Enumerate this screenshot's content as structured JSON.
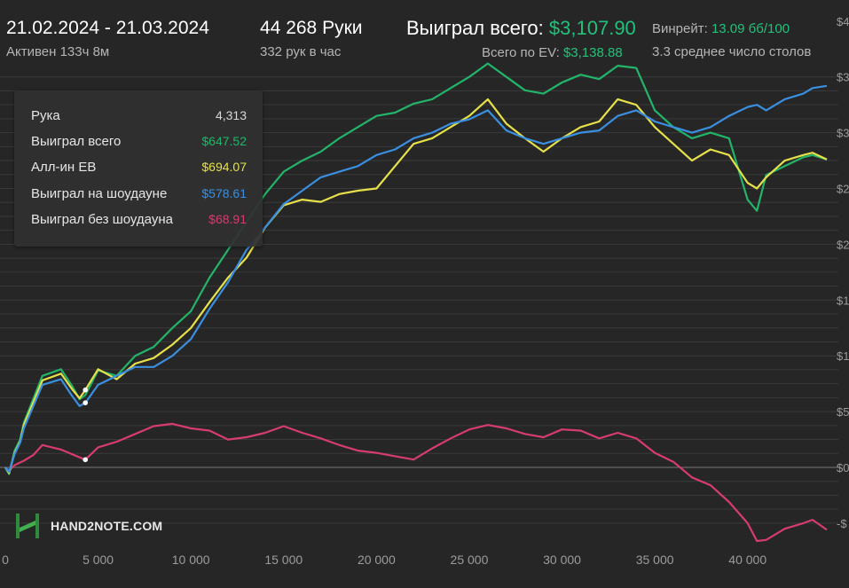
{
  "header": {
    "date_range": "21.02.2024 - 21.03.2024",
    "active_time": "Активен 133ч 8м",
    "hands_count": "44 268 Руки",
    "hands_per_hour": "332 рук в час",
    "won_total_label": "Выиграл всего:",
    "won_total_value": "$3,107.90",
    "ev_total_label": "Всего по EV:",
    "ev_total_value": "$3,138.88",
    "winrate_label": "Винрейт:",
    "winrate_value": "13.09 бб/100",
    "avg_tables": "3.3 среднее число столов"
  },
  "tooltip": {
    "rows": [
      {
        "label": "Рука",
        "value": "4,313",
        "color": "#d8d8d8"
      },
      {
        "label": "Выиграл всего",
        "value": "$647.52",
        "color": "#22b56a"
      },
      {
        "label": "Алл-ин ЕВ",
        "value": "$694.07",
        "color": "#e6e04a"
      },
      {
        "label": "Выиграл на шоудауне",
        "value": "$578.61",
        "color": "#3a8fe0"
      },
      {
        "label": "Выиграл без шоудауна",
        "value": "$68.91",
        "color": "#d63c6e"
      }
    ]
  },
  "logo": {
    "text": "HAND2NOTE.COM",
    "icon": "hand2note-logo-icon"
  },
  "chart_data": {
    "type": "line",
    "x_axis": {
      "range": [
        0,
        44268
      ],
      "ticks": [
        0,
        5000,
        10000,
        15000,
        20000,
        25000,
        30000,
        35000,
        40000
      ],
      "tick_labels": [
        "0",
        "5 000",
        "10 000",
        "15 000",
        "20 000",
        "25 000",
        "30 000",
        "35 000",
        "40 000"
      ]
    },
    "y_axis": {
      "position": "right",
      "range": [
        -600,
        4000
      ],
      "tick_values": [
        -500,
        0,
        500,
        1000,
        1500,
        2000,
        2500,
        3000,
        3500,
        4000
      ],
      "tick_labels": [
        "-$",
        "$0",
        "$5",
        "$1",
        "$1",
        "$2",
        "$2",
        "$3",
        "$3",
        "$4"
      ]
    },
    "grid": true,
    "series": [
      {
        "name": "Выиграл всего",
        "color": "#22b56a",
        "x": [
          0,
          200,
          500,
          800,
          1000,
          2000,
          3000,
          3600,
          4000,
          4313,
          5000,
          6000,
          7000,
          8000,
          9000,
          10000,
          11000,
          12000,
          13000,
          14000,
          15000,
          16000,
          17000,
          18000,
          19000,
          20000,
          21000,
          22000,
          23000,
          24000,
          25000,
          26000,
          27000,
          28000,
          29000,
          30000,
          31000,
          32000,
          33000,
          34000,
          35000,
          36000,
          37000,
          38000,
          39000,
          40000,
          40500,
          41000,
          42000,
          43000,
          43500,
          44268
        ],
        "y": [
          0,
          -60,
          150,
          250,
          400,
          820,
          880,
          730,
          610,
          648,
          870,
          820,
          1000,
          1080,
          1250,
          1400,
          1700,
          1950,
          2200,
          2450,
          2650,
          2750,
          2830,
          2950,
          3050,
          3150,
          3180,
          3260,
          3300,
          3400,
          3500,
          3620,
          3500,
          3380,
          3350,
          3450,
          3520,
          3480,
          3600,
          3580,
          3200,
          3050,
          2950,
          3000,
          2950,
          2400,
          2300,
          2620,
          2700,
          2780,
          2800,
          2760
        ]
      },
      {
        "name": "Алл-ин ЕВ",
        "color": "#e6e04a",
        "x": [
          0,
          200,
          500,
          800,
          1000,
          2000,
          3000,
          3600,
          4000,
          4313,
          5000,
          6000,
          7000,
          8000,
          9000,
          10000,
          11000,
          12000,
          13000,
          14000,
          15000,
          16000,
          17000,
          18000,
          19000,
          20000,
          21000,
          22000,
          23000,
          24000,
          25000,
          26000,
          27000,
          28000,
          29000,
          30000,
          31000,
          32000,
          33000,
          34000,
          35000,
          36000,
          37000,
          38000,
          39000,
          40000,
          40500,
          41000,
          42000,
          43000,
          43500,
          44268
        ],
        "y": [
          0,
          -50,
          130,
          230,
          380,
          780,
          840,
          700,
          620,
          694,
          880,
          790,
          930,
          980,
          1100,
          1250,
          1480,
          1700,
          1880,
          2150,
          2350,
          2400,
          2380,
          2450,
          2480,
          2500,
          2700,
          2900,
          2950,
          3050,
          3150,
          3300,
          3080,
          2950,
          2830,
          2950,
          3050,
          3100,
          3300,
          3250,
          3050,
          2900,
          2750,
          2850,
          2800,
          2550,
          2500,
          2600,
          2750,
          2800,
          2820,
          2760
        ]
      },
      {
        "name": "Выиграл на шоудауне",
        "color": "#3a8fe0",
        "x": [
          0,
          200,
          500,
          800,
          1000,
          2000,
          3000,
          3600,
          4000,
          4313,
          5000,
          6000,
          7000,
          8000,
          9000,
          10000,
          11000,
          12000,
          13000,
          14000,
          15000,
          16000,
          17000,
          18000,
          19000,
          20000,
          21000,
          22000,
          23000,
          24000,
          25000,
          26000,
          27000,
          28000,
          29000,
          30000,
          31000,
          32000,
          33000,
          34000,
          35000,
          36000,
          37000,
          38000,
          39000,
          40000,
          40500,
          41000,
          42000,
          43000,
          43500,
          44268
        ],
        "y": [
          0,
          -40,
          120,
          220,
          350,
          740,
          790,
          640,
          550,
          579,
          740,
          820,
          900,
          900,
          1000,
          1150,
          1420,
          1660,
          1950,
          2150,
          2360,
          2480,
          2600,
          2650,
          2700,
          2800,
          2850,
          2950,
          3000,
          3080,
          3120,
          3200,
          3020,
          2950,
          2900,
          2950,
          3000,
          3020,
          3150,
          3200,
          3100,
          3050,
          3000,
          3050,
          3150,
          3230,
          3250,
          3200,
          3300,
          3350,
          3400,
          3420
        ]
      },
      {
        "name": "Выиграл без шоудауна",
        "color": "#d63c6e",
        "x": [
          0,
          200,
          500,
          1000,
          1500,
          2000,
          3000,
          4000,
          4313,
          5000,
          6000,
          7000,
          8000,
          9000,
          10000,
          11000,
          12000,
          13000,
          14000,
          15000,
          16000,
          17000,
          18000,
          19000,
          20000,
          21000,
          22000,
          23000,
          24000,
          25000,
          26000,
          27000,
          28000,
          29000,
          30000,
          31000,
          32000,
          33000,
          34000,
          35000,
          36000,
          37000,
          38000,
          39000,
          40000,
          40500,
          41000,
          42000,
          43000,
          43500,
          44268
        ],
        "y": [
          0,
          -30,
          20,
          60,
          110,
          200,
          160,
          90,
          69,
          180,
          230,
          300,
          370,
          390,
          350,
          330,
          250,
          270,
          310,
          370,
          310,
          260,
          200,
          150,
          130,
          100,
          70,
          170,
          260,
          340,
          380,
          350,
          300,
          270,
          340,
          330,
          260,
          310,
          260,
          130,
          50,
          -90,
          -160,
          -310,
          -500,
          -660,
          -650,
          -550,
          -500,
          -470,
          -560
        ]
      }
    ]
  }
}
